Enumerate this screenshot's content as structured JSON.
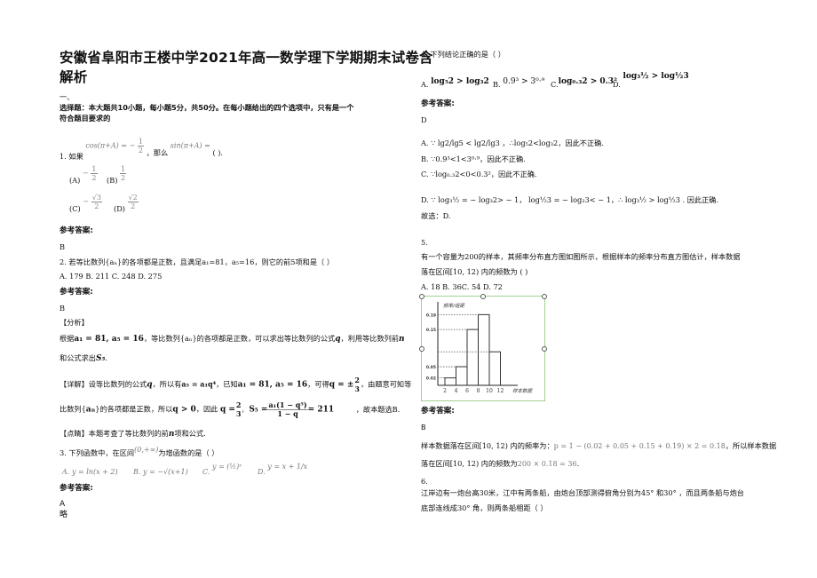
{
  "document": {
    "title_line1": "安徽省阜阳市王楼中学2021年高一数学理下学期期末试卷含",
    "title_line2": "解析",
    "section_num": "一、",
    "section_desc_line1": "选择题：本大题共10小题，每小题5分，共50分。在每小题给出的四个选项中，只有是一个",
    "section_desc_line2": "符合题目要求的",
    "answer_header": "参考答案:"
  },
  "questions": {
    "q1": {
      "prefix": "1. 如果",
      "cond": "cos(π+A) = −",
      "cond_num": "1",
      "cond_den": "2",
      "mid": "，那么",
      "ask": "sin(π+A) =",
      "tail": "(   ).",
      "options": [
        {
          "label": "(A)",
          "sign": "−",
          "num": "1",
          "den": "2"
        },
        {
          "label": "(B)",
          "sign": "",
          "num": "1",
          "den": "2"
        },
        {
          "label": "(C)",
          "sign": "−",
          "num": "√3",
          "den": "2"
        },
        {
          "label": "(D)",
          "sign": "",
          "num": "√2",
          "den": "2"
        }
      ],
      "answer": "B"
    },
    "q2": {
      "stem": "2. 若等比数列{aₙ}的各项都是正数，且满足a₁=81，a₅=16，则它的前5项和是（    ）",
      "options": "A. 179  B. 211  C. 248  D. 275",
      "answer": "B",
      "analysis_tag": "【分析】",
      "analysis_l1_pre": "根据",
      "analysis_l1_math": "a₁ = 81, a₅ = 16",
      "analysis_l1_mid": "，等比数列{aₙ}的各项都是正数，可以求出等比数列的公式",
      "analysis_l1_q": "q",
      "analysis_l1_post": "，利用等比数列前",
      "analysis_l1_n": "n",
      "analysis_l2_pre": "和公式求出",
      "analysis_l2_math": "S₅",
      "detail_tag": "【详解】",
      "detail_l1_a": "设等比数列的公式",
      "detail_l1_q": "q",
      "detail_l1_b": "，所以有",
      "detail_l1_m1": "a₅ = a₁q⁴",
      "detail_l1_c": "，已知",
      "detail_l1_m2": "a₁ = 81, a₅ = 16",
      "detail_l1_d": "，可得",
      "detail_l1_m3": "q = ±",
      "detail_l1_m3_num": "2",
      "detail_l1_m3_den": "3",
      "detail_l1_e": "，由题意可知等",
      "detail_l2_a": "比数列{",
      "detail_l2_an": "aₙ",
      "detail_l2_b": "}的各项都是正数，所以",
      "detail_l2_m1": "q > 0",
      "detail_l2_c": "，因此",
      "detail_l2_q": "q =",
      "detail_l2_q_num": "2",
      "detail_l2_q_den": "3",
      "detail_l2_s": "S₅ =",
      "detail_l2_s_num": "a₁(1 − q⁵)",
      "detail_l2_s_den": "1 − q",
      "detail_l2_s_val": "= 211",
      "detail_l2_d": "，故本题选B.",
      "comment_tag": "【点睛】",
      "comment_a": "本题考查了等比数列的前",
      "comment_n": "n",
      "comment_b": "项和公式."
    },
    "q3": {
      "stem_pre": "3. 下列函数中，在区间",
      "interval": "(0,+∞)",
      "stem_post": "为增函数的是（         ）",
      "options": [
        {
          "label": "A.",
          "expr": "y = ln(x + 2)"
        },
        {
          "label": "B.",
          "expr": "y = −√(x+1)"
        },
        {
          "label": "C.",
          "expr": "y = (½)ˣ"
        },
        {
          "label": "D.",
          "expr": "y = x + 1/x"
        }
      ],
      "answer": "A",
      "note": "略"
    },
    "q4": {
      "stem": "4. 下列结论正确的是（     ）",
      "options": [
        {
          "label": "A.",
          "expr": "log₅2 > log₃2"
        },
        {
          "label": "B.",
          "expr": "0.9³ > 3⁰·⁹"
        },
        {
          "label": "C.",
          "expr": "log₀.₃2 > 0.3²"
        },
        {
          "label": "D.",
          "expr": "log₃½ > log½3"
        }
      ],
      "answer": "D",
      "exp_a": "A. ∵ lg2/lg5 < lg2/lg3 ，∴log₅2<log₃2，因此不正确.",
      "exp_b": "B. ∵0.9³<1<3⁰·⁹，因此不正确.",
      "exp_c": "C. ∵log₀.₃2<0<0.3²，因此不正确.",
      "exp_d": "D. ∵ log₃½ = − log₃2> − 1，  log½3 = − log₂3< − 1，∴ log₃½ >  log½3  . 因此正确.",
      "conclusion": "故选：D."
    },
    "q5": {
      "number": "5.",
      "stem_l1": "有一个容量为200的样本，其频率分布直方图如图所示，根据样本的频率分布直方图估计，样本数据",
      "stem_l2": "落在区间[10, 12) 内的频数为          (          )",
      "options": "A. 18        B. 36C. 54        D. 72",
      "answer": "B",
      "exp_l1_pre": "样本数据落在区间[10, 12) 内的频率为：",
      "exp_l1_math": "p = 1 − (0.02 + 0.05 + 0.15 + 0.19) × 2 = 0.18",
      "exp_l1_post": "，所以样本数据",
      "exp_l2_pre": "落在区间[10, 12) 内的频数为",
      "exp_l2_math": "200 × 0.18 = 36",
      "exp_l2_post": "."
    },
    "q6": {
      "number": "6.",
      "stem_l1": "江岸边有一炮台高30米，江中有两条船，由炮台顶部测得俯角分别为45°  和30° ，而且两条船与炮台",
      "stem_l2": "底部连线成30° 角，则两条船相距（        ）"
    }
  },
  "chart_data": {
    "type": "bar",
    "title": "",
    "ylabel": "频率/组距",
    "xlabel": "样本数据",
    "categories": [
      "[2,4)",
      "[4,6)",
      "[6,8)",
      "[8,10)",
      "[10,12)"
    ],
    "x_tick_labels": [
      "2",
      "4",
      "6",
      "8",
      "10",
      "12"
    ],
    "y_tick_labels": [
      "0.02",
      "0.05",
      "0.15",
      "0.19"
    ],
    "values": [
      0.02,
      0.05,
      0.15,
      0.19,
      0.09
    ],
    "ylim": [
      0,
      0.21
    ],
    "grid": false
  }
}
